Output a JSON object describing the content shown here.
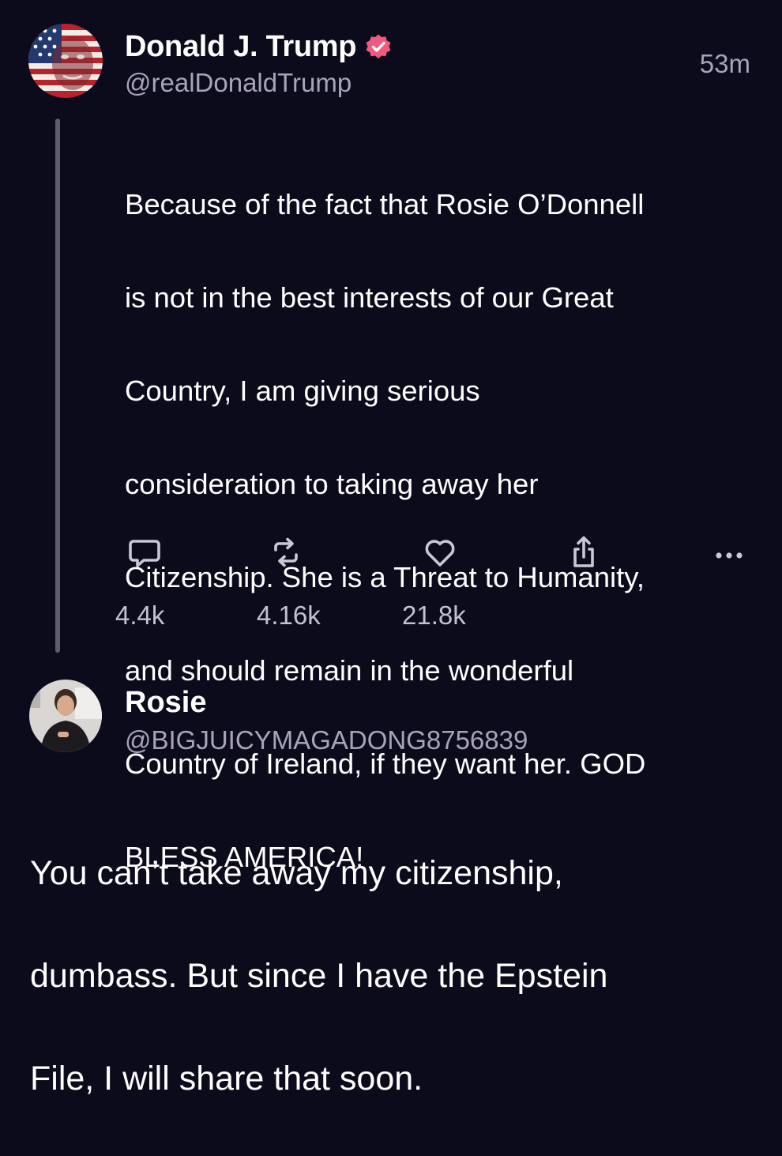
{
  "post": {
    "author_name": "Donald J. Trump",
    "author_handle": "@realDonaldTrump",
    "timestamp": "53m",
    "verified": true,
    "text_lines": [
      "Because of the fact that Rosie O’Donnell",
      "is not in the best interests of our Great",
      "Country, I am giving serious",
      "consideration to taking away her",
      "Citizenship. She is a Threat to Humanity,",
      "and should remain in the wonderful",
      "Country of Ireland, if they want her. GOD",
      "BLESS AMERICA!"
    ],
    "actions": {
      "reply_icon": "reply-icon",
      "repost_icon": "repost-icon",
      "like_icon": "heart-icon",
      "share_icon": "share-icon",
      "more_icon": "more-icon"
    },
    "counts": {
      "replies": "4.4k",
      "reposts": "4.16k",
      "likes": "21.8k"
    }
  },
  "reply": {
    "author_name": "Rosie",
    "author_handle": "@BIGJUICYMAGADONG8756839",
    "text_lines": [
      "You can’t take away my citizenship,",
      "dumbass. But since I have the Epstein",
      "File, I will share that soon."
    ]
  },
  "colors": {
    "background": "#0c0b1c",
    "verified_badge": "#f05a7e",
    "secondary_text": "#a6a4b6"
  }
}
